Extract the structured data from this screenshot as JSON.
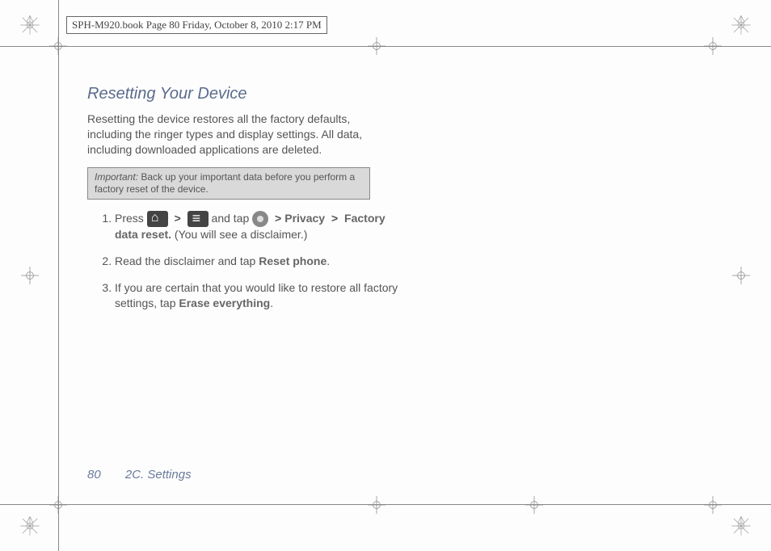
{
  "header": {
    "meta": "SPH-M920.book  Page 80  Friday, October 8, 2010  2:17 PM"
  },
  "title": "Resetting Your Device",
  "intro": "Resetting the device restores all the factory defaults, including the ringer types and display settings. All data, including downloaded applications are deleted.",
  "important": {
    "label": "Important:",
    "text": "Back up your important data before you perform a factory reset of the device."
  },
  "step1": {
    "press": "Press",
    "andtap": " and tap ",
    "privacy": "Privacy",
    "factory": "Factory data reset.",
    "tail": " (You will see a disclaimer.)"
  },
  "step2": {
    "pre": "Read the disclaimer and tap ",
    "bold": "Reset phone",
    "post": "."
  },
  "step3": {
    "pre": "If you are certain that you would like to restore all factory settings, tap ",
    "bold": "Erase everything",
    "post": "."
  },
  "footer": {
    "page": "80",
    "section": "2C. Settings"
  },
  "sep": ">"
}
